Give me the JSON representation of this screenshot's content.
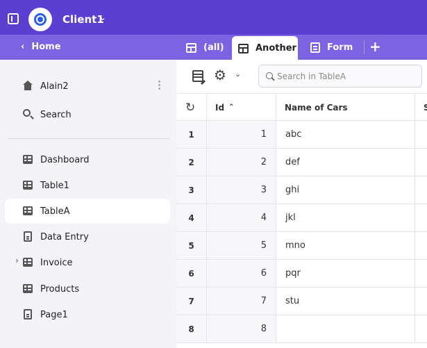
{
  "header": {
    "client_name": "Client1"
  },
  "nav": {
    "home_label": "Home",
    "tabs": [
      {
        "label": "(all)"
      },
      {
        "label": "Another"
      },
      {
        "label": "Form"
      }
    ],
    "add_tab_label": "+"
  },
  "sidebar": {
    "user": "Alain2",
    "search": "Search",
    "items": [
      {
        "label": "Dashboard",
        "icon": "table-icon"
      },
      {
        "label": "Table1",
        "icon": "table-icon"
      },
      {
        "label": "TableA",
        "icon": "table-icon"
      },
      {
        "label": "Data Entry",
        "icon": "page-icon"
      },
      {
        "label": "Invoice",
        "icon": "table-icon"
      },
      {
        "label": "Products",
        "icon": "table-icon"
      },
      {
        "label": "Page1",
        "icon": "page-icon"
      }
    ]
  },
  "toolbar": {
    "search_placeholder": "Search in TableA"
  },
  "table": {
    "columns": [
      "Id",
      "Name of Cars",
      "S"
    ],
    "rows": [
      {
        "row": "1",
        "id": "1",
        "name": "abc"
      },
      {
        "row": "2",
        "id": "2",
        "name": "def"
      },
      {
        "row": "3",
        "id": "3",
        "name": "ghi"
      },
      {
        "row": "4",
        "id": "4",
        "name": "jkl"
      },
      {
        "row": "5",
        "id": "5",
        "name": "mno"
      },
      {
        "row": "6",
        "id": "6",
        "name": "pqr"
      },
      {
        "row": "7",
        "id": "7",
        "name": "stu"
      },
      {
        "row": "8",
        "id": "8",
        "name": ""
      }
    ]
  },
  "colors": {
    "topbar": "#5b3fd1",
    "tabbar": "#7b63e2",
    "accent": "#2c5ee8"
  }
}
